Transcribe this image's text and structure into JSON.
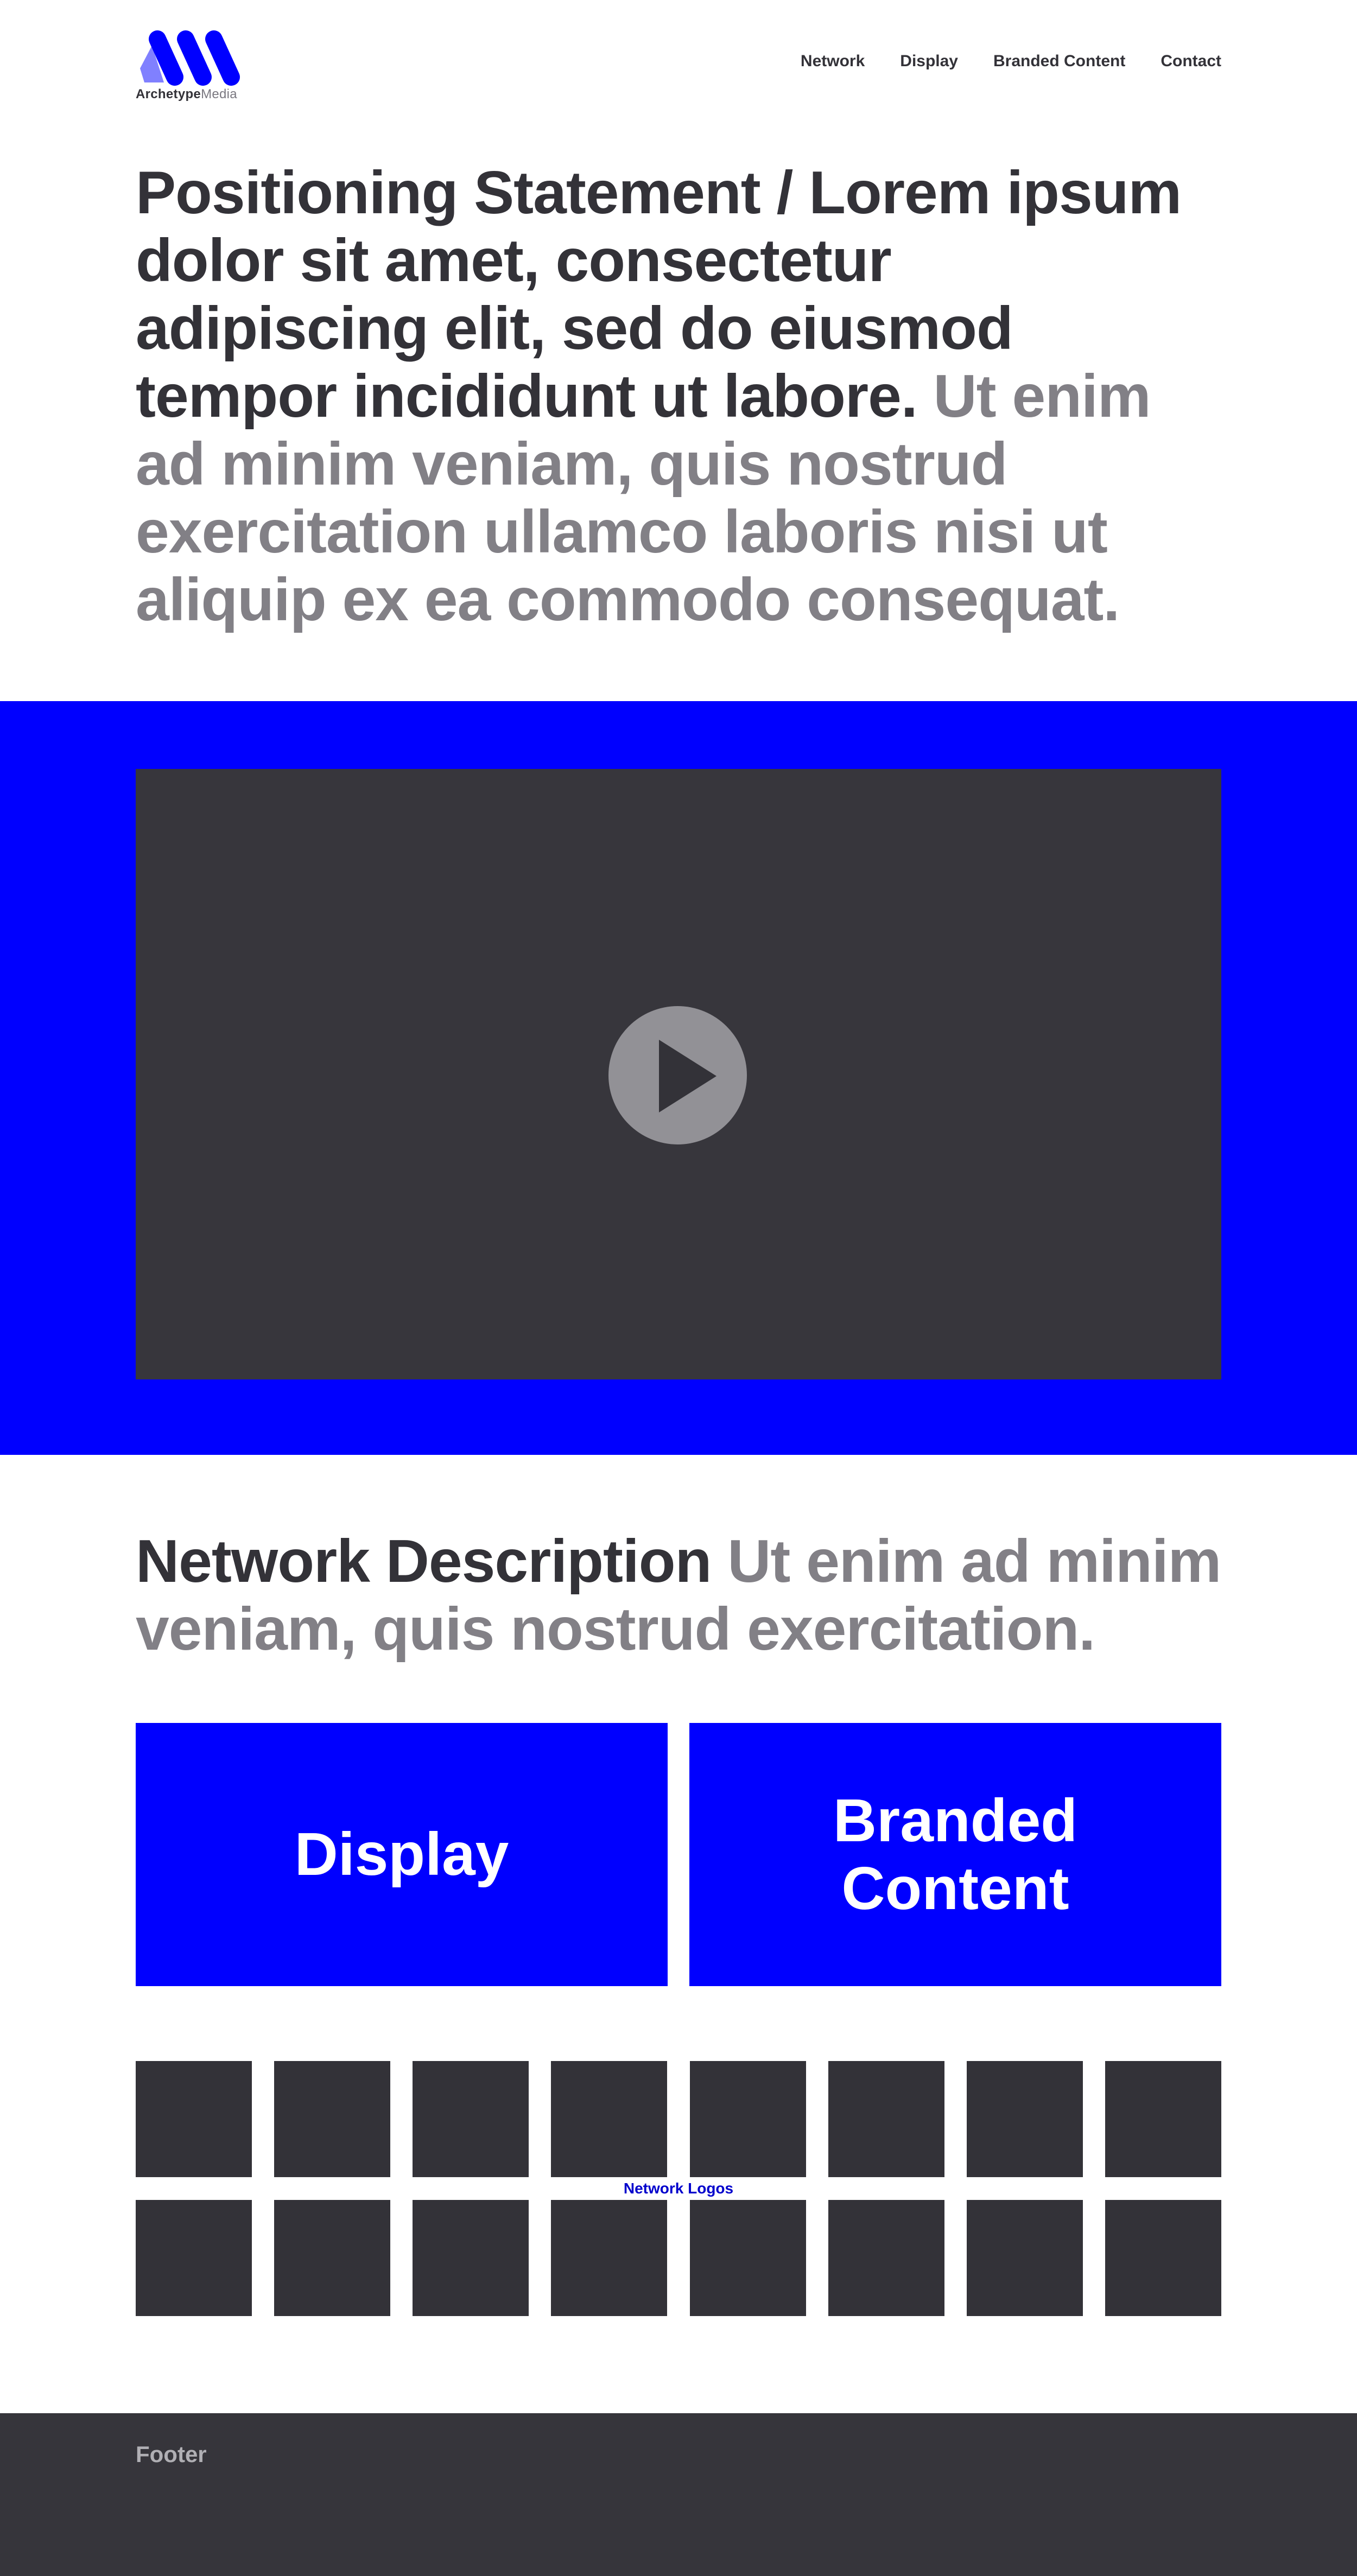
{
  "brand": {
    "name_bold": "Archetype",
    "name_light": "Media",
    "accent": "#0000ff",
    "logo_light": "#8080ff"
  },
  "nav": {
    "items": [
      {
        "label": "Network"
      },
      {
        "label": "Display"
      },
      {
        "label": "Branded Content"
      },
      {
        "label": "Contact"
      }
    ]
  },
  "hero": {
    "statement_dark": "Positioning Statement / Lorem ipsum dolor sit amet, consectetur adipiscing elit, sed do eiusmod tempor incididunt ut labore.",
    "statement_grey": "Ut enim ad minim veniam, quis nostrud exercitation ullamco laboris nisi ut aliquip ex ea commodo consequat."
  },
  "video": {
    "icon": "play-icon",
    "band_color": "#0000ff",
    "player_color": "#37363c"
  },
  "network": {
    "title_dark": "Network Description",
    "title_grey": "Ut enim ad minim veniam, quis nostrud exercitation."
  },
  "cards": {
    "display": "Display",
    "branded": "Branded Content"
  },
  "logos": {
    "label": "Network Logos",
    "rows": 2,
    "columns": 8
  },
  "footer": {
    "label": "Footer",
    "color": "#36353b"
  }
}
